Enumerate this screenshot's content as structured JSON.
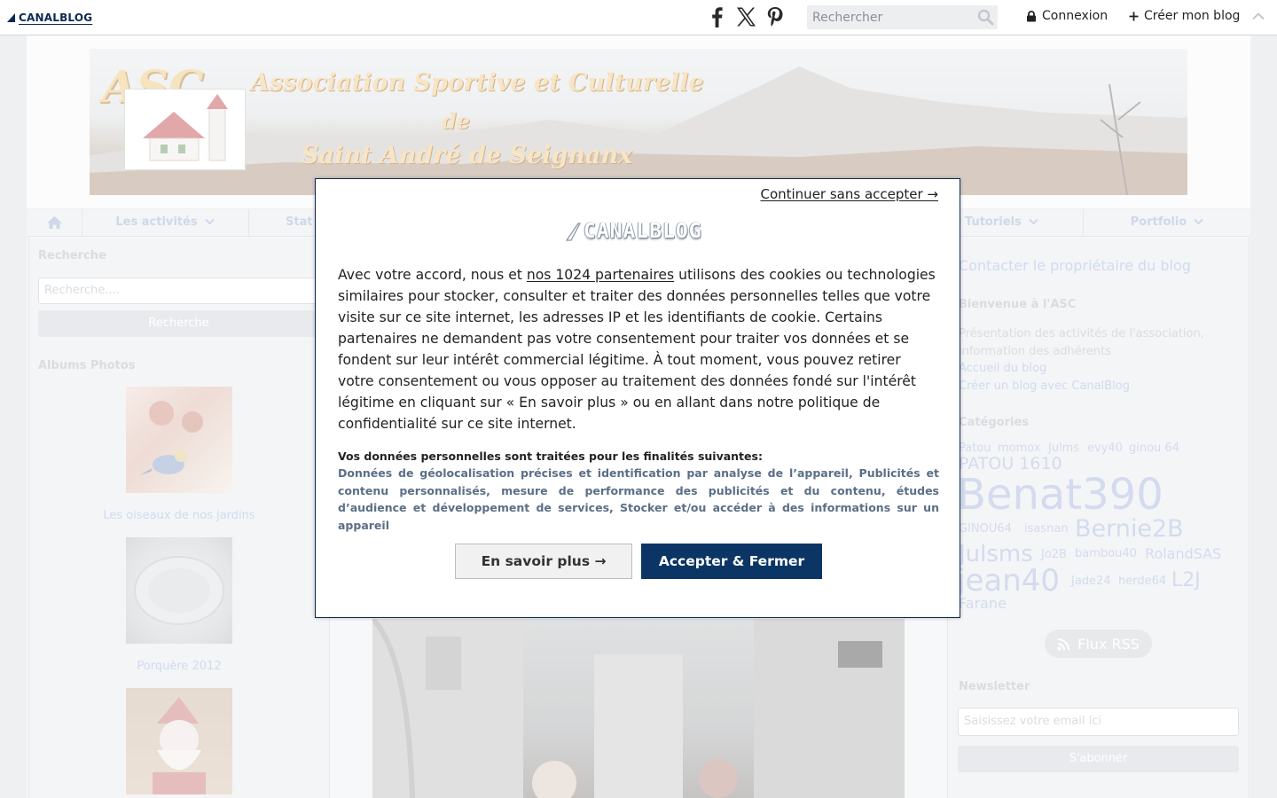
{
  "topbar": {
    "logo_text": "CANALBLOG",
    "search_placeholder": "Rechercher",
    "login_label": "Connexion",
    "create_label": "Créer mon blog"
  },
  "banner": {
    "asc": "ASC",
    "line1": "Association Sportive et Culturelle",
    "line2": "de",
    "line3": "Saint André de Seignanx"
  },
  "nav": {
    "items": [
      {
        "label": "Les activités"
      },
      {
        "label": "Stat"
      },
      {
        "label": "Tutoriels"
      },
      {
        "label": "Portfolio"
      }
    ]
  },
  "left": {
    "search_title": "Recherche",
    "search_placeholder": "Recherche....",
    "search_button": "Recherche",
    "albums_title": "Albums Photos",
    "albums": [
      {
        "caption": "Les oiseaux de nos jardins"
      },
      {
        "caption": "Porquère 2012"
      }
    ]
  },
  "right": {
    "contact_link": "Contacter le propriétaire du blog",
    "welcome_title": "Bienvenue à l'ASC",
    "welcome_text": "Présentation des activités de l'association, information des adhérents",
    "home_link": "Accueil du blog",
    "create_link": "Créer un blog avec CanalBlog",
    "categories_title": "Catégories",
    "tags": [
      "Patou",
      "momox",
      "Julms",
      "evy40",
      "ginou 64",
      "PATOU 1610",
      "Benat390",
      "GINOU64",
      "isasnan",
      "Bernie2B",
      "Julsms",
      "Jo2B",
      "bambou40",
      "RolandSAS",
      "jean40",
      "Jade24",
      "herde64",
      "L2J",
      "Farane"
    ],
    "rss_label": "Flux RSS",
    "newsletter_title": "Newsletter",
    "newsletter_placeholder": "Saisissez votre email ici",
    "subscribe_label": "S'abonner"
  },
  "consent": {
    "skip_label": "Continuer sans accepter →",
    "logo_text": "CANALBLOG",
    "text_before": "Avec votre accord, nous et ",
    "partners_link": "nos 1024 partenaires",
    "text_after": " utilisons des cookies ou technologies similaires pour stocker, consulter et traiter des données personnelles telles que votre visite sur ce site internet, les adresses IP et les identifiants de cookie. Certains partenaires ne demandent pas votre consentement pour traiter vos données et se fondent sur leur intérêt commercial légitime. À tout moment, vous pouvez retirer votre consentement ou vous opposer au traitement des données fondé sur l'intérêt légitime en cliquant sur « En savoir plus » ou en allant dans notre politique de confidentialité sur ce site internet.",
    "purposes_title": "Vos données personnelles sont traitées pour les finalités suivantes:",
    "purposes_list": "Données de géolocalisation précises et identification par analyse de l’appareil, Publicités et contenu personnalisés, mesure de performance des publicités et du contenu, études d’audience et développement de services, Stocker et/ou accéder à des informations sur un appareil",
    "more_label": "En savoir plus →",
    "accept_label": "Accepter & Fermer"
  },
  "colors": {
    "brand_navy": "#0b3564",
    "link_purple": "#b7c8e8"
  }
}
